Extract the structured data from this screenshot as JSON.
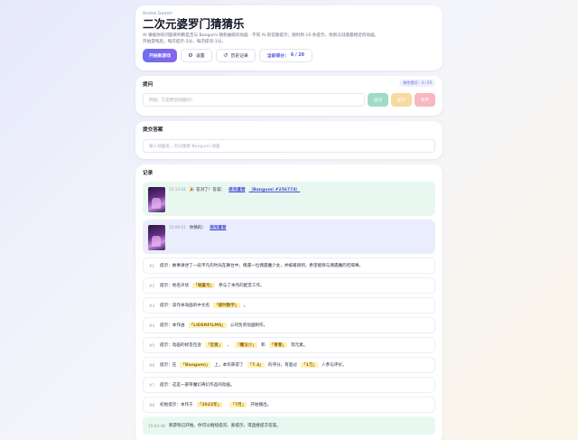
{
  "header": {
    "eyebrow": "Anime Game!",
    "title": "二次元婆罗门猜猜乐",
    "desc_line1": "AI 根据你的问题来判断是否与 Bangumi 随机抽取的动画 · 不同 AI 的答题提示；随时到 10 条提示，找到与谜底最相近的动画。",
    "desc_line2": "开始游戏后，每次提示-2分，每次提问-1分。",
    "start_label": "开始新游戏",
    "settings_label": "设置",
    "history_label": "历史记录",
    "score_label": "当前得分：",
    "score_value": "6 / 20"
  },
  "ask": {
    "title": "提问",
    "remaining": "剩余提问：4 / 20",
    "placeholder": "例如：它是原创动画吗？",
    "yes_label": "提问",
    "hint_label": "提示",
    "giveup_label": "放弃"
  },
  "answer": {
    "title": "提交答案",
    "placeholder": "输入动画名，可以搜索 Bangumi 动画"
  },
  "records": {
    "title": "记录",
    "items": [
      {
        "type": "correct",
        "time": "15:13:04",
        "prefix": "🎉 答对了！答案：",
        "name": "摇曳露营",
        "suffix": "（Bangumi #256774）"
      },
      {
        "type": "guess",
        "time": "15:08:51",
        "prefix": "你猜的：",
        "name": "摇曳露营"
      },
      {
        "type": "hint",
        "num": "#1",
        "text_a": "提示：故事讲述了一段平凡的时光在舞台中，偶遇一位偶遇魔少女，并被邀请到，希望能够与偶遇魔的吃喝事。"
      },
      {
        "type": "hint",
        "num": "#2",
        "text_a": "提示：他名声优",
        "hl1": "「堀蒼月」",
        "text_b": "参与了本作的配音工作。"
      },
      {
        "type": "hint",
        "num": "#3",
        "text_a": "提示：该作本动画的中文名",
        "hl1": "「摇时散学」",
        "text_b": "。"
      },
      {
        "type": "hint",
        "num": "#4",
        "text_a": "提示：本作由",
        "hl1": "「LIDENFILMS」",
        "text_b": "公司负责动画制作。"
      },
      {
        "type": "hint",
        "num": "#5",
        "text_a": "提示：动画的标签包含",
        "hl1": "「恋爱」",
        "text_b": "、",
        "hl2": "「魔法少」",
        "text_c": "和",
        "hl3": "「青春」",
        "text_d": "等元素。"
      },
      {
        "type": "hint",
        "num": "#6",
        "text_a": "提示：在",
        "hl1": "「Bangumi」",
        "text_b": "上，本作获得了",
        "hl2": "「7.4」",
        "text_c": "的评分，有超过",
        "hl3": "「1万」",
        "text_d": "人参与评价。"
      },
      {
        "type": "hint",
        "num": "#7",
        "text_a": "提示：这是一部带魔幻奇幻作品的动画。"
      },
      {
        "type": "hint",
        "num": "#8",
        "text_a": "初始提示：本作于",
        "hl1": "「2022年」",
        "text_b": "",
        "hl2": "「7月」",
        "text_c": "开始播出。"
      },
      {
        "type": "final",
        "time": "15:03:48",
        "text": "新游戏已开始。你可以继续提问、索提示，或直接提交答案。"
      }
    ]
  }
}
